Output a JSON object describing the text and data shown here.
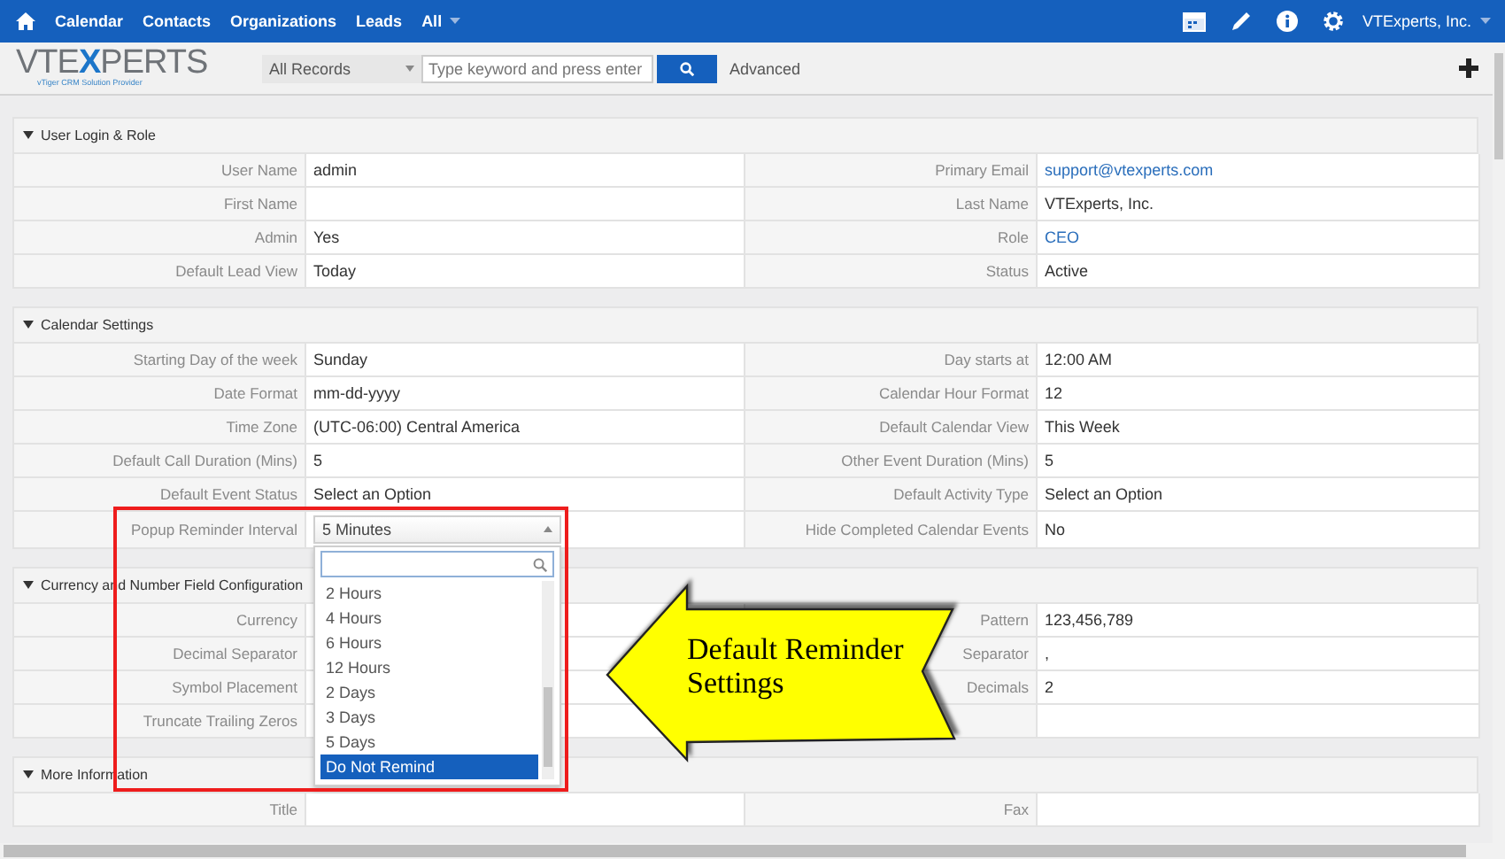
{
  "top_nav": {
    "items": [
      {
        "label": "Calendar"
      },
      {
        "label": "Contacts"
      },
      {
        "label": "Organizations"
      },
      {
        "label": "Leads"
      },
      {
        "label": "All",
        "dropdown": true
      }
    ],
    "account": "VTExperts, Inc."
  },
  "header": {
    "logo": {
      "parts": [
        {
          "text": "VTE",
          "accent": false
        },
        {
          "text": "X",
          "accent": true
        },
        {
          "text": "PERTS",
          "accent": false
        }
      ],
      "tagline": "vTiger CRM Solution Provider"
    },
    "search_scope": "All Records",
    "search": {
      "placeholder": "Type keyword and press enter"
    },
    "advanced": "Advanced"
  },
  "sections": [
    {
      "title": "User Login & Role",
      "expanded": true,
      "rows": [
        [
          {
            "label": "User Name",
            "value": "admin",
            "link": false
          },
          {
            "label": "Primary Email",
            "value": "support@vtexperts.com",
            "link": true
          }
        ],
        [
          {
            "label": "First Name"
          },
          {
            "label": "Last Name",
            "value": "VTExperts, Inc.",
            "link": false
          }
        ],
        [
          {
            "label": "Admin",
            "value": "Yes",
            "link": false
          },
          {
            "label": "Role",
            "value": "CEO",
            "link": true
          }
        ],
        [
          {
            "label": "Default Lead View",
            "value": "Today",
            "link": false
          },
          {
            "label": "Status",
            "value": "Active",
            "link": false
          }
        ]
      ]
    },
    {
      "title": "Calendar Settings",
      "expanded": true,
      "rows": [
        [
          {
            "label": "Starting Day of the week",
            "value": "Sunday",
            "link": false
          },
          {
            "label": "Day starts at",
            "value": "12:00 AM",
            "link": false
          }
        ],
        [
          {
            "label": "Date Format",
            "value": "mm-dd-yyyy",
            "link": false
          },
          {
            "label": "Calendar Hour Format",
            "value": "12",
            "link": false
          }
        ],
        [
          {
            "label": "Time Zone",
            "value": "(UTC-06:00) Central America",
            "link": false
          },
          {
            "label": "Default Calendar View",
            "value": "This Week",
            "link": false
          }
        ],
        [
          {
            "label": "Default Call Duration (Mins)",
            "value": "5",
            "link": false
          },
          {
            "label": "Other Event Duration (Mins)",
            "value": "5",
            "link": false
          }
        ],
        [
          {
            "label": "Default Event Status",
            "value": "Select an Option",
            "link": false
          },
          {
            "label": "Default Activity Type",
            "value": "Select an Option",
            "link": false
          }
        ],
        [
          {
            "label": "Popup Reminder Interval",
            "kind": "select",
            "value": "5 Minutes",
            "open": true,
            "options": [
              {
                "label": "2 Hours",
                "selected": false
              },
              {
                "label": "4 Hours",
                "selected": false
              },
              {
                "label": "6 Hours",
                "selected": false
              },
              {
                "label": "12 Hours",
                "selected": false
              },
              {
                "label": "2 Days",
                "selected": false
              },
              {
                "label": "3 Days",
                "selected": false
              },
              {
                "label": "5 Days",
                "selected": false
              },
              {
                "label": "Do Not Remind",
                "selected": true
              }
            ]
          },
          {
            "label": "Hide Completed Calendar Events",
            "value": "No",
            "link": false
          }
        ]
      ]
    },
    {
      "title": "Currency and Number Field Configuration",
      "expanded": true,
      "rows": [
        [
          {
            "label": "Currency"
          },
          {
            "label": "Pattern",
            "value": "123,456,789",
            "link": false
          }
        ],
        [
          {
            "label": "Decimal Separator"
          },
          {
            "label": "Separator",
            "value": ",",
            "link": false
          }
        ],
        [
          {
            "label": "Symbol Placement"
          },
          {
            "label": "Decimals",
            "value": "2",
            "link": false
          }
        ],
        [
          {
            "label": "Truncate Trailing Zeros"
          },
          {}
        ]
      ]
    },
    {
      "title": "More Information",
      "expanded": true,
      "rows": [
        [
          {
            "label": "Title"
          },
          {
            "label": "Fax"
          }
        ]
      ]
    }
  ],
  "callout": {
    "text": "Default Reminder Settings"
  }
}
